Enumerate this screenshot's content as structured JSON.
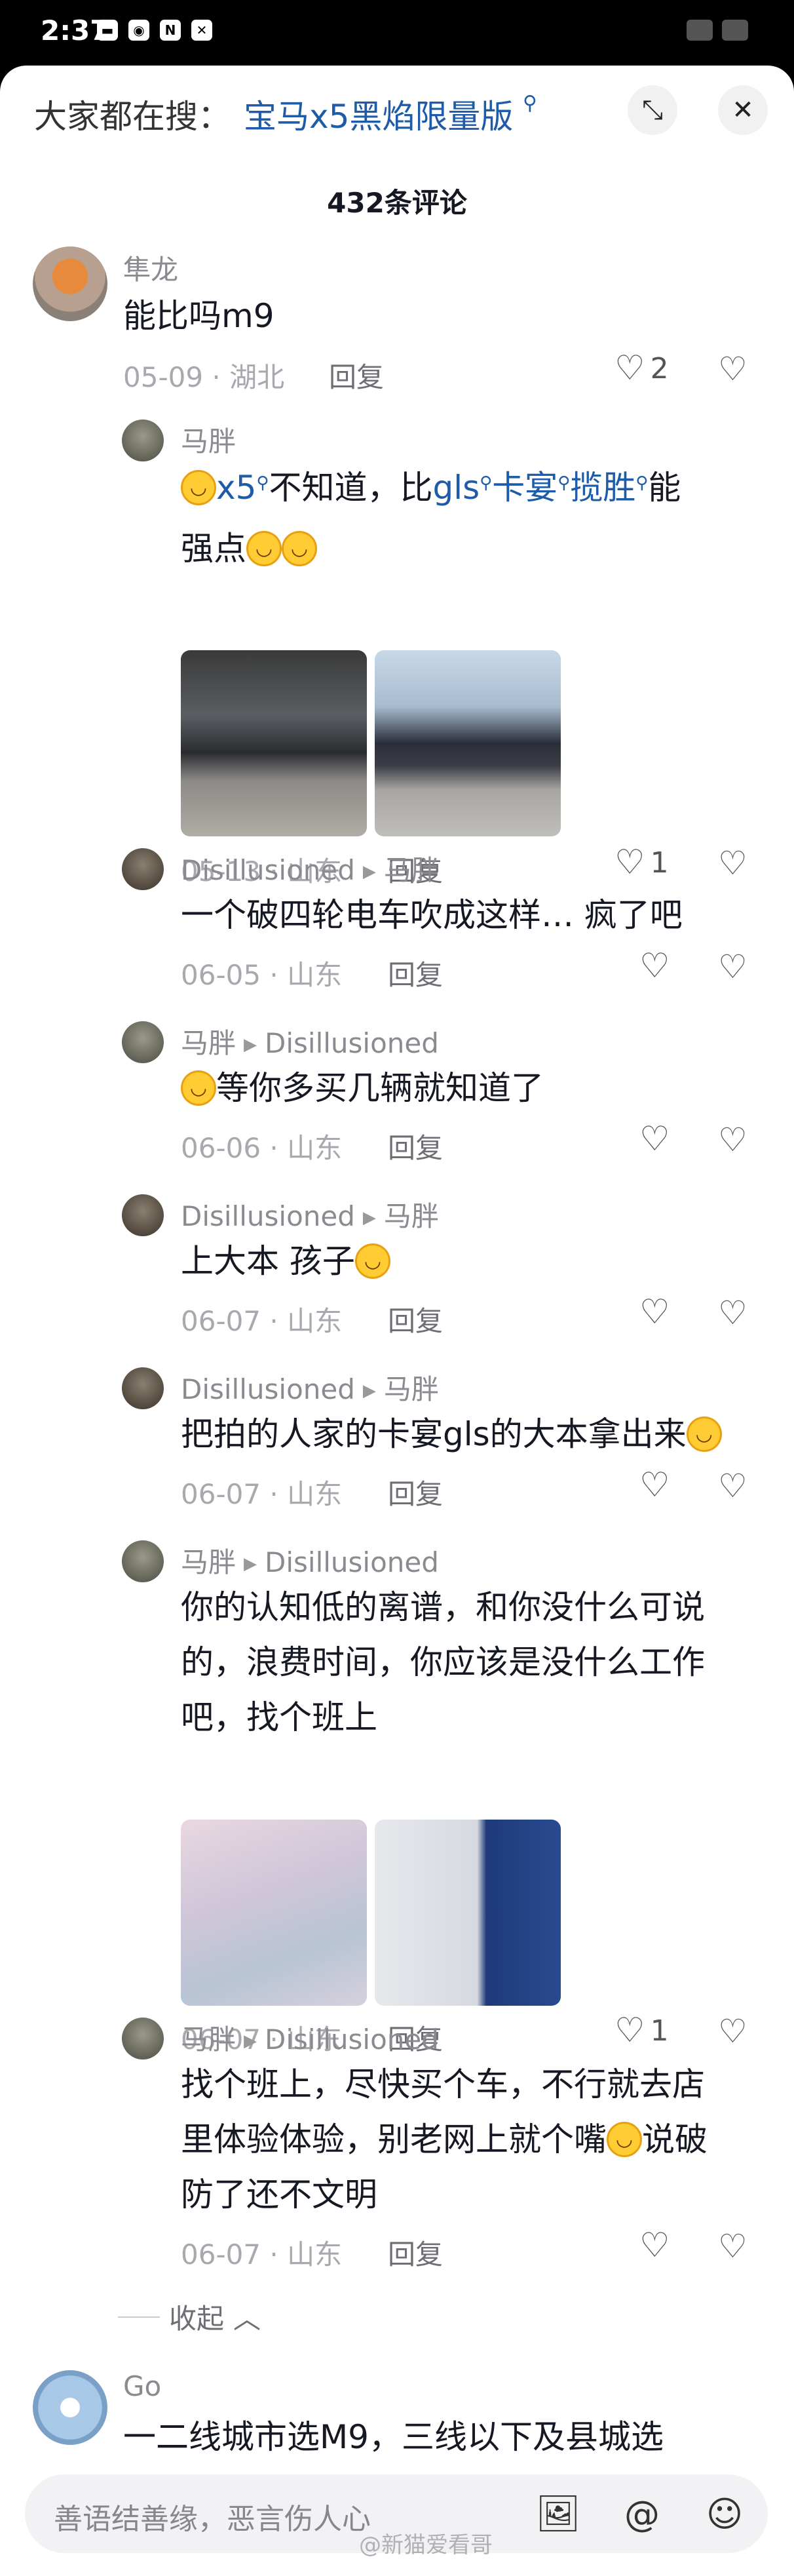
{
  "status": {
    "time": "2:37"
  },
  "header": {
    "search_prefix": "大家都在搜：",
    "search_link": "宝马x5黑焰限量版"
  },
  "comments_count": "432条评论",
  "comments": [
    {
      "author": "隼龙",
      "text": "能比吗m9",
      "date": "05-09 · 湖北",
      "reply": "回复",
      "likes": "2"
    },
    {
      "author": "马胖",
      "text_parts": [
        "x5",
        "不知道，比",
        "gls",
        "卡宴",
        "揽胜",
        "能",
        "强点"
      ],
      "date": "05-13 · 山东",
      "reply": "回复",
      "likes": "1"
    },
    {
      "author": "Disillusioned",
      "to": "马胖",
      "text": "一个破四轮电车吹成这样… 疯了吧",
      "date": "06-05 · 山东",
      "reply": "回复"
    },
    {
      "author": "马胖",
      "to": "Disillusioned",
      "text": "等你多买几辆就知道了",
      "date": "06-06 · 山东",
      "reply": "回复"
    },
    {
      "author": "Disillusioned",
      "to": "马胖",
      "text": "上大本 孩子",
      "date": "06-07 · 山东",
      "reply": "回复"
    },
    {
      "author": "Disillusioned",
      "to": "马胖",
      "text": "把拍的人家的卡宴gls的大本拿出来",
      "date": "06-07 · 山东",
      "reply": "回复"
    },
    {
      "author": "马胖",
      "to": "Disillusioned",
      "lines": [
        "你的认知低的离谱，和你没什么可说",
        "的，浪费时间，你应该是没什么工作",
        "吧，找个班上"
      ],
      "date": "06-07 · 山东",
      "reply": "回复",
      "likes": "1"
    },
    {
      "author": "马胖",
      "to": "Disillusioned",
      "lines": [
        "找个班上，尽快买个车，不行就去店",
        "里体验体验，别老网上就个嘴",
        "防了还不文明"
      ],
      "line2_tail": "说破",
      "date": "06-07 · 山东",
      "reply": "回复"
    },
    {
      "author": "Go",
      "text": "一二线城市选M9，三线以下及县城选"
    }
  ],
  "collapse_label": "收起",
  "input": {
    "placeholder": "善语结善缘，恶言伤人心",
    "watermark": "@新猫爱看哥"
  },
  "colors": {
    "link": "#1e5ba8",
    "meta": "#a8a8ae",
    "emoji": "#ffcc33"
  }
}
